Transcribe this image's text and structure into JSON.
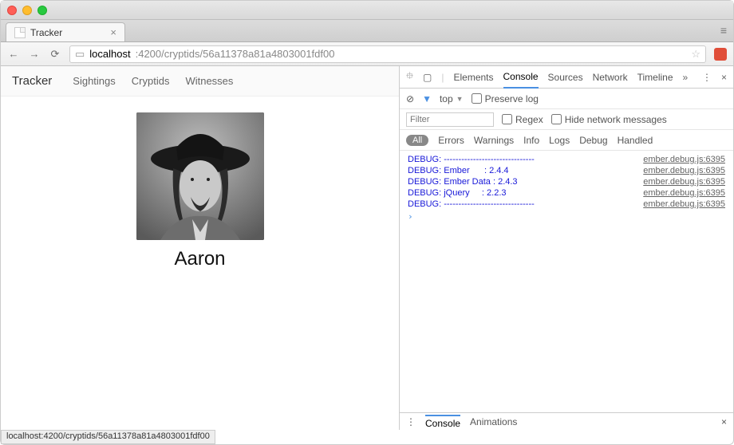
{
  "browser": {
    "tab_title": "Tracker",
    "url_host": "localhost",
    "url_port_path": ":4200/cryptids/56a11378a81a4803001fdf00",
    "status_text": "localhost:4200/cryptids/56a11378a81a4803001fdf00"
  },
  "app": {
    "title": "Tracker",
    "nav": [
      "Sightings",
      "Cryptids",
      "Witnesses"
    ],
    "profile_name": "Aaron"
  },
  "devtools": {
    "tabs": [
      "Elements",
      "Console",
      "Sources",
      "Network",
      "Timeline"
    ],
    "active_tab": "Console",
    "context": "top",
    "preserve_log_label": "Preserve log",
    "filter_placeholder": "Filter",
    "regex_label": "Regex",
    "hide_network_label": "Hide network messages",
    "levels": [
      "All",
      "Errors",
      "Warnings",
      "Info",
      "Logs",
      "Debug",
      "Handled"
    ],
    "console": [
      {
        "msg": "DEBUG: -------------------------------",
        "src": "ember.debug.js:6395"
      },
      {
        "msg": "DEBUG: Ember      : 2.4.4",
        "src": "ember.debug.js:6395"
      },
      {
        "msg": "DEBUG: Ember Data : 2.4.3",
        "src": "ember.debug.js:6395"
      },
      {
        "msg": "DEBUG: jQuery     : 2.2.3",
        "src": "ember.debug.js:6395"
      },
      {
        "msg": "DEBUG: -------------------------------",
        "src": "ember.debug.js:6395"
      }
    ],
    "drawer": {
      "tabs": [
        "Console",
        "Animations"
      ],
      "active": "Console"
    }
  }
}
